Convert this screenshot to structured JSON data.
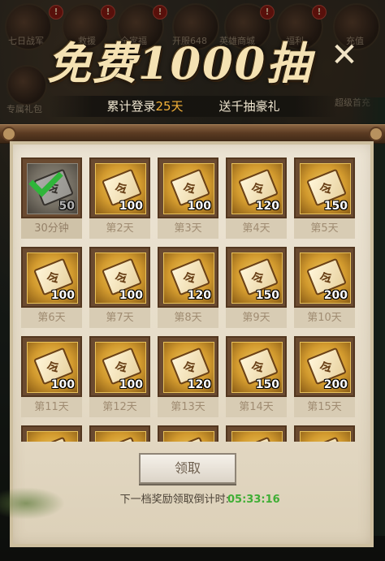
{
  "background": {
    "top_labels": [
      "七日战军",
      "救援",
      "全家福",
      "开服648",
      "英雄商城",
      "福利",
      "充值"
    ],
    "left_label": "专属礼包",
    "right_label": "超级首充",
    "badge": "!"
  },
  "title": "免费1000抽",
  "subtitle": {
    "prefix": "累计登录",
    "days": "25天",
    "suffix": "送千抽豪礼"
  },
  "rewards": [
    {
      "day": "30分钟",
      "qty": "50",
      "claimed": true
    },
    {
      "day": "第2天",
      "qty": "100",
      "claimed": false
    },
    {
      "day": "第3天",
      "qty": "100",
      "claimed": false
    },
    {
      "day": "第4天",
      "qty": "120",
      "claimed": false
    },
    {
      "day": "第5天",
      "qty": "150",
      "claimed": false
    },
    {
      "day": "第6天",
      "qty": "100",
      "claimed": false
    },
    {
      "day": "第7天",
      "qty": "100",
      "claimed": false
    },
    {
      "day": "第8天",
      "qty": "120",
      "claimed": false
    },
    {
      "day": "第9天",
      "qty": "150",
      "claimed": false
    },
    {
      "day": "第10天",
      "qty": "200",
      "claimed": false
    },
    {
      "day": "第11天",
      "qty": "100",
      "claimed": false
    },
    {
      "day": "第12天",
      "qty": "100",
      "claimed": false
    },
    {
      "day": "第13天",
      "qty": "120",
      "claimed": false
    },
    {
      "day": "第14天",
      "qty": "150",
      "claimed": false
    },
    {
      "day": "第15天",
      "qty": "200",
      "claimed": false
    },
    {
      "day": "",
      "qty": "",
      "claimed": false
    },
    {
      "day": "",
      "qty": "",
      "claimed": false
    },
    {
      "day": "",
      "qty": "",
      "claimed": false
    },
    {
      "day": "",
      "qty": "",
      "claimed": false
    },
    {
      "day": "",
      "qty": "",
      "claimed": false
    }
  ],
  "claim_button": "领取",
  "countdown": {
    "label": "下一档奖励领取倒计时:",
    "time": "05:33:16"
  },
  "colors": {
    "accent_days": "#f3b23a",
    "countdown": "#3fae35",
    "check": "#2fb53a"
  },
  "icons": {
    "close": "close-icon",
    "check": "check-icon",
    "reward": "scroll-ticket-icon"
  }
}
